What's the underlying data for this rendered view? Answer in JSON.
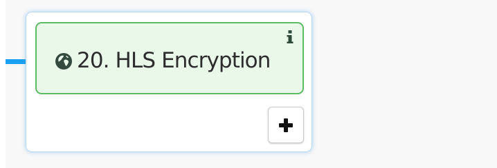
{
  "node": {
    "title": "20. HLS Encryption",
    "icon": "globe-icon",
    "info_icon": "info-icon",
    "add_icon": "plus-icon",
    "colors": {
      "header_background": "#eaf8ea",
      "header_border": "#5dbb62",
      "connector": "#1aa0f2",
      "card_border": "#b4d8f6",
      "icon_dark": "#2f4a3a"
    }
  }
}
